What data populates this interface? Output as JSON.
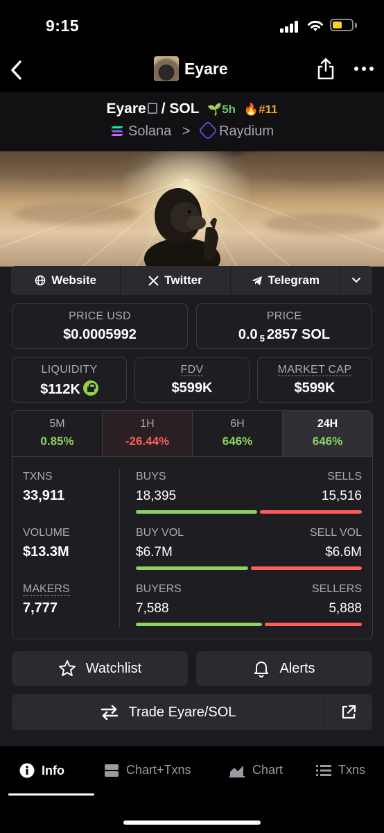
{
  "status": {
    "time": "9:15"
  },
  "nav": {
    "title": "Eyare"
  },
  "pair": {
    "base": "Eyare",
    "separator": "/",
    "quote": "SOL",
    "age": "5h",
    "rank": "#11",
    "chain": "Solana",
    "chevron": ">",
    "dex": "Raydium"
  },
  "links": {
    "website": "Website",
    "twitter": "Twitter",
    "telegram": "Telegram"
  },
  "price_usd": {
    "label": "PRICE USD",
    "value": "$0.0005992"
  },
  "price_native": {
    "label": "PRICE",
    "prefix": "0.0",
    "subscript": "5",
    "digits": "2857",
    "unit": "SOL"
  },
  "liquidity": {
    "label": "LIQUIDITY",
    "value": "$112K"
  },
  "fdv": {
    "label": "FDV",
    "value": "$599K"
  },
  "market_cap": {
    "label": "MARKET CAP",
    "value": "$599K"
  },
  "periods": [
    {
      "label": "5M",
      "value": "0.85%"
    },
    {
      "label": "1H",
      "value": "-26.44%"
    },
    {
      "label": "6H",
      "value": "646%"
    },
    {
      "label": "24H",
      "value": "646%"
    }
  ],
  "txns": {
    "label": "TXNS",
    "value": "33,911",
    "buys_label": "BUYS",
    "buys": "18,395",
    "sells_label": "SELLS",
    "sells": "15,516"
  },
  "volume": {
    "label": "VOLUME",
    "value": "$13.3M",
    "buy_label": "BUY VOL",
    "buy": "$6.7M",
    "sell_label": "SELL VOL",
    "sell": "$6.6M"
  },
  "makers": {
    "label": "MAKERS",
    "value": "7,777",
    "buyers_label": "BUYERS",
    "buyers": "7,588",
    "sellers_label": "SELLERS",
    "sellers": "5,888"
  },
  "buy_ratio": {
    "txns": 0.542,
    "volume": 0.504,
    "makers": 0.563
  },
  "actions": {
    "watchlist": "Watchlist",
    "alerts": "Alerts",
    "trade": "Trade Eyare/SOL"
  },
  "tabs": {
    "info": "Info",
    "chart_txns": "Chart+Txns",
    "chart": "Chart",
    "txns": "Txns"
  },
  "colors": {
    "positive": "#8ed15e",
    "negative": "#ff5c5c",
    "age": "#69c969",
    "rank": "#f5a623",
    "battery": "#f7d11d"
  }
}
